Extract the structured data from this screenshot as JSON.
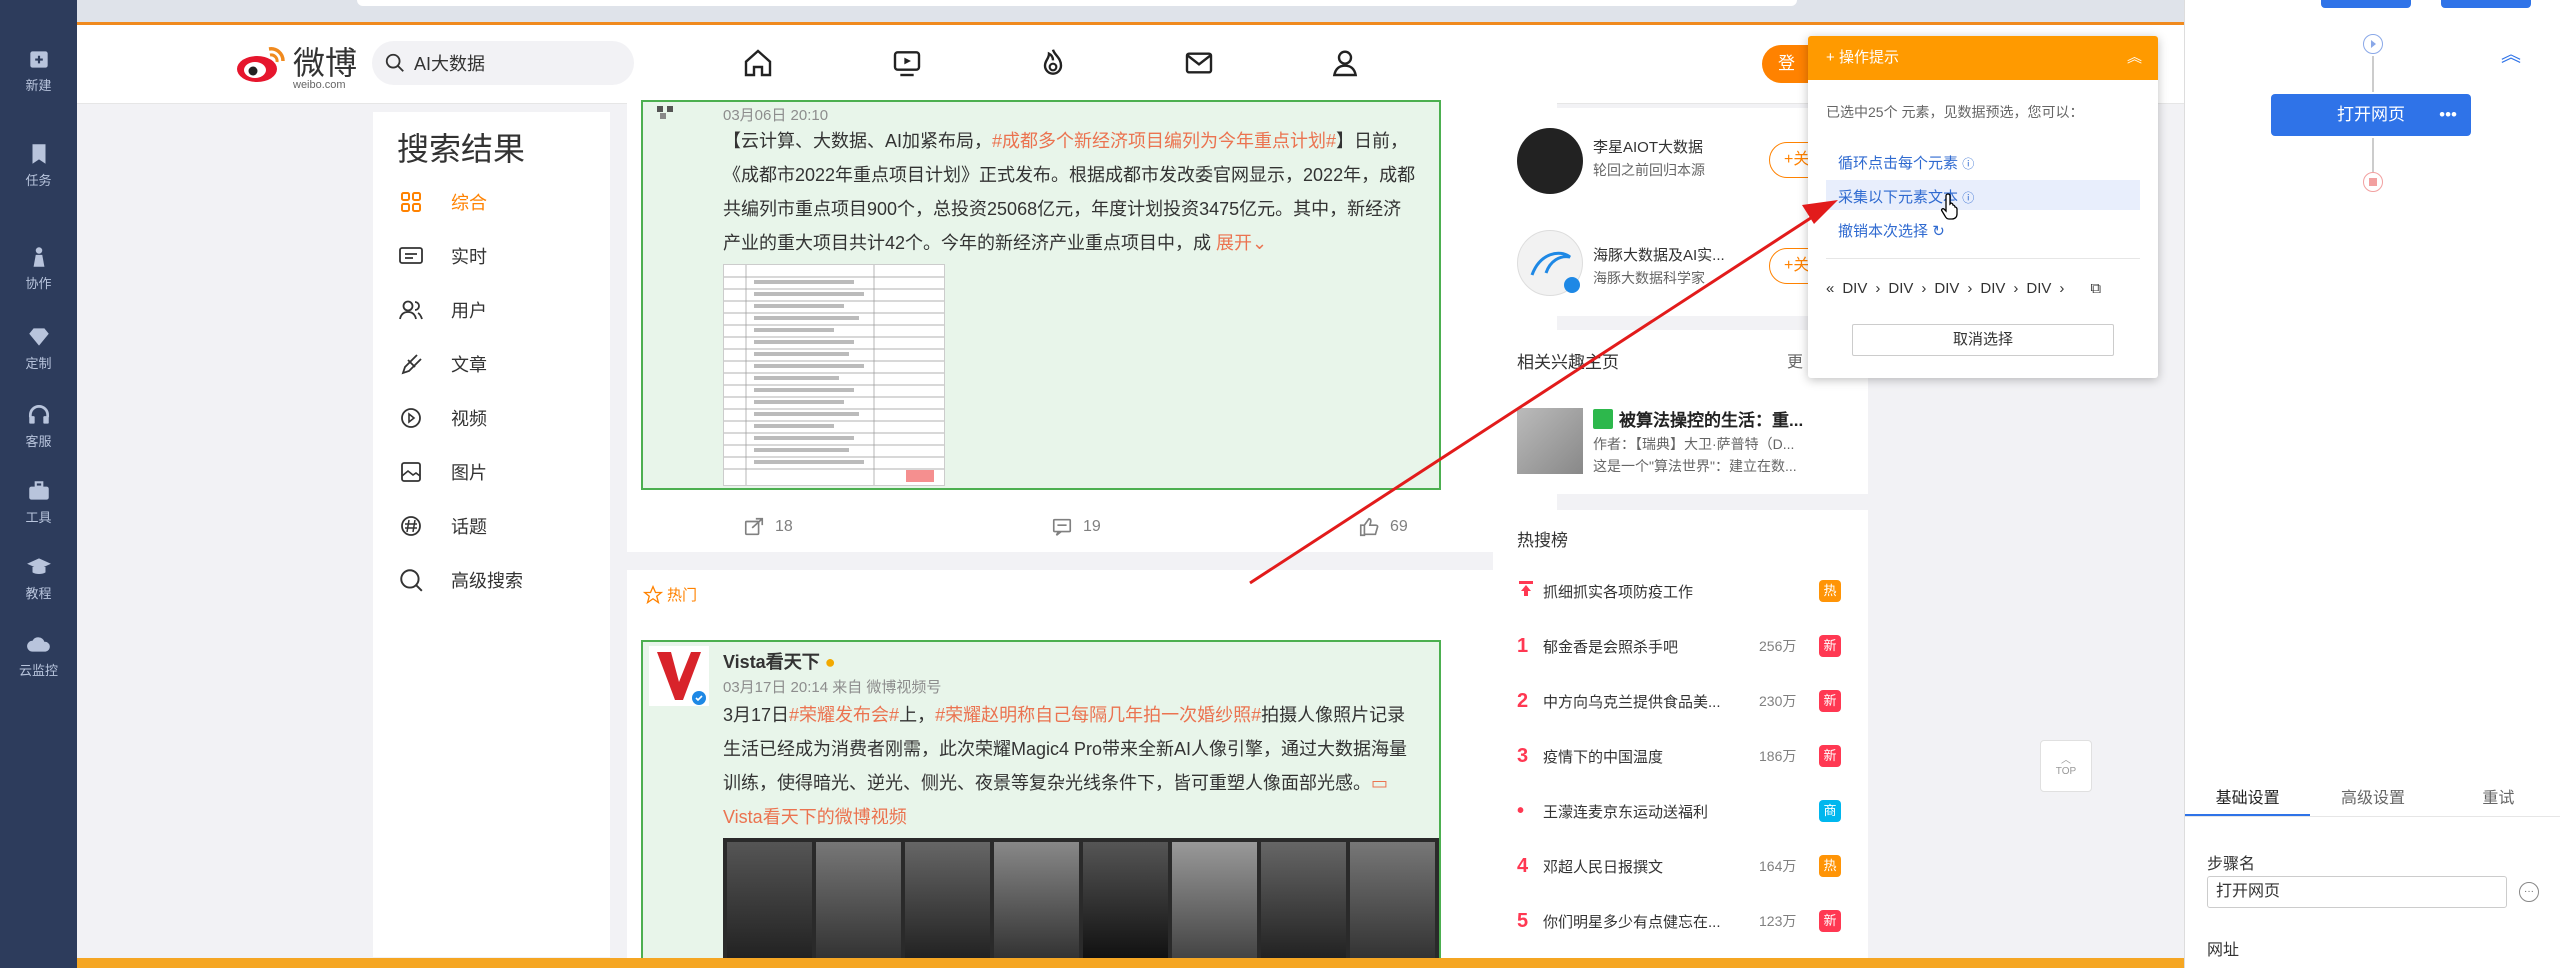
{
  "rail": {
    "items": [
      "新建",
      "任务",
      "协作",
      "定制",
      "客服",
      "工具",
      "教程",
      "云监控"
    ]
  },
  "weibo": {
    "logo_name": "微博",
    "logo_url": "weibo.com",
    "search_value": "AI大数据",
    "login_label": "登"
  },
  "left_menu": {
    "title": "搜索结果",
    "items": [
      {
        "label": "综合",
        "icon": "grid-icon"
      },
      {
        "label": "实时",
        "icon": "realtime-icon"
      },
      {
        "label": "用户",
        "icon": "users-icon"
      },
      {
        "label": "文章",
        "icon": "article-icon"
      },
      {
        "label": "视频",
        "icon": "video-icon"
      },
      {
        "label": "图片",
        "icon": "image-icon"
      },
      {
        "label": "话题",
        "icon": "topic-icon"
      },
      {
        "label": "高级搜索",
        "icon": "search-icon"
      }
    ]
  },
  "post1": {
    "time": "03月06日 20:10",
    "line1a": "【云计算、大数据、AI加紧布局，",
    "line1b": "#成都多个新经济项目编列为今年重点计划#",
    "line1c": "】日前，",
    "line2": "《成都市2022年重点项目计划》正式发布。根据成都市发改委官网显示，2022年，成都",
    "line3": "共编列市重点项目900个，总投资25068亿元，年度计划投资3475亿元。其中，新经济",
    "line4": "产业的重大项目共计42个。今年的新经济产业重点项目中，成",
    "expand": "展开",
    "forward": "18",
    "comment": "19",
    "like": "69"
  },
  "post2": {
    "hot_label": "热门",
    "author": "Vista看天下",
    "time": "03月17日 20:14",
    "source": "来自 微博视频号",
    "l1a": "3月17日",
    "l1b": "#荣耀发布会#",
    "l1c": "上，",
    "l1d": "#荣耀赵明称自己每隔几年拍一次婚纱照#",
    "l1e": "拍摄人像照片记录",
    "l2": "生活已经成为消费者刚需，此次荣耀Magic4 Pro带来全新AI人像引擎，通过大数据海量",
    "l3": "训练，使得暗光、逆光、侧光、夜景等复杂光线条件下，皆可重塑人像面部光感。",
    "l4": "Vista看天下的微博视频"
  },
  "right": {
    "user1_name": "李星AIOT大数据",
    "user1_desc": "轮回之前回归本源",
    "user2_name": "海豚大数据及AI实...",
    "user2_desc": "海豚大数据科学家",
    "follow": "+关",
    "related_title": "相关兴趣主页",
    "related_more": "更",
    "book_title": "被算法操控的生活：重...",
    "book_author": "作者：【瑞典】大卫·萨普特（D...",
    "book_desc": "这是一个\"算法世界\"：建立在数...",
    "hot_title": "热搜榜",
    "hot": [
      {
        "rank": "",
        "text": "抓细抓实各项防疫工作",
        "val": "",
        "tag": "热",
        "tagc": "#ff9406"
      },
      {
        "rank": "1",
        "text": "郁金香是会照杀手吧",
        "val": "256万",
        "tag": "新",
        "tagc": "#ff3852"
      },
      {
        "rank": "2",
        "text": "中方向乌克兰提供食品美...",
        "val": "230万",
        "tag": "新",
        "tagc": "#ff3852"
      },
      {
        "rank": "3",
        "text": "疫情下的中国温度",
        "val": "186万",
        "tag": "新",
        "tagc": "#ff3852"
      },
      {
        "rank": "•",
        "text": "王濛连麦京东运动送福利",
        "val": "",
        "tag": "商",
        "tagc": "#00b7ee"
      },
      {
        "rank": "4",
        "text": "邓超人民日报撰文",
        "val": "164万",
        "tag": "热",
        "tagc": "#ff9406"
      },
      {
        "rank": "5",
        "text": "你们明星多少有点健忘在...",
        "val": "123万",
        "tag": "新",
        "tagc": "#ff3852"
      }
    ]
  },
  "tooltip": {
    "title": "操作提示",
    "desc": "已选中25个 元素，见数据预选，您可以：",
    "link1": "循环点击每个元素",
    "link2": "采集以下元素文本",
    "link3": "撤销本次选择",
    "crumb": "DIV",
    "cancel": "取消选择"
  },
  "workflow": {
    "node_label": "打开网页",
    "tabs": [
      "基础设置",
      "高级设置",
      "重试"
    ],
    "step_label": "步骤名",
    "step_value": "打开网页",
    "url_label": "网址"
  },
  "top_back": "TOP"
}
